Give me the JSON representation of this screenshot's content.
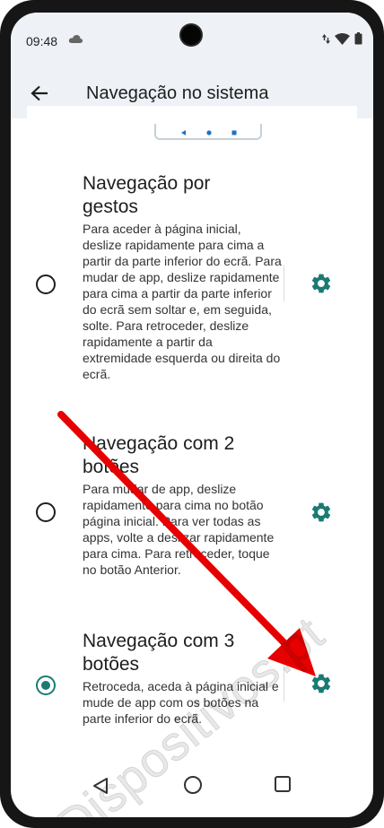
{
  "status": {
    "time": "09:48"
  },
  "appbar": {
    "title": "Navegação no sistema"
  },
  "options": [
    {
      "title": "Navegação por gestos",
      "description": "Para aceder à página inicial, deslize rapidamente para cima a partir da parte inferior do ecrã. Para mudar de app, deslize rapidamente para cima a partir da parte inferior do ecrã sem soltar e, em seguida, solte. Para retroceder, deslize rapidamente a partir da extremidade esquerda ou direita do ecrã.",
      "selected": false
    },
    {
      "title": "Navegação com 2 botões",
      "description": "Para mudar de app, deslize rapidamente para cima no botão página inicial. Para ver todas as apps, volte a deslizar rapidamente para cima. Para retroceder, toque no botão Anterior.",
      "selected": false
    },
    {
      "title": "Navegação com 3 botões",
      "description": "Retroceda, aceda à página inicial e mude de app com os botões na parte inferior do ecrã.",
      "selected": true
    }
  ],
  "watermark": "Dispositivos.pt",
  "colors": {
    "accent": "#1a7b73",
    "arrow": "#e60000",
    "topbar": "#eef1f6"
  }
}
